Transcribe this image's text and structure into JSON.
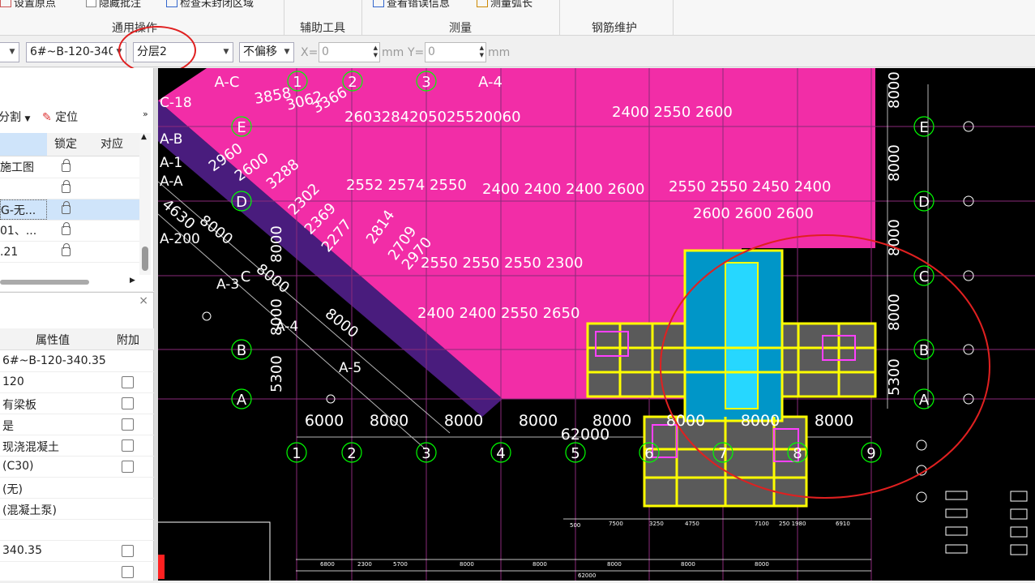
{
  "ribbon": {
    "set_origin": "设置原点",
    "hide_annotation": "隐藏批注",
    "check_closed_area": "检查未封闭区域",
    "view_error_info": "查看错误信息",
    "measure_arc": "测量弧长",
    "groups": [
      "通用操作",
      "辅助工具",
      "测量",
      "钢筋维护"
    ]
  },
  "toolbar": {
    "component_select": "6#~B-120-340",
    "layer_select": "分层2",
    "offset_select": "不偏移",
    "x_label": "X=",
    "x_value": "0",
    "y_label": "Y=",
    "y_value": "0",
    "unit": "mm"
  },
  "layer_panel": {
    "split_label": "分割",
    "locate_label": "定位",
    "columns": [
      "锁定",
      "对应"
    ],
    "rows": [
      {
        "name": "施工图"
      },
      {
        "name": ""
      },
      {
        "name": "G-无..."
      },
      {
        "name": "01、..."
      },
      {
        "name": ".21"
      }
    ]
  },
  "properties_panel": {
    "header_value": "属性值",
    "header_extra": "附加",
    "rows": [
      {
        "value": "6#~B-120-340.35",
        "checkbox": false
      },
      {
        "value": "120",
        "checkbox": true
      },
      {
        "value": "有梁板",
        "checkbox": true
      },
      {
        "value": "是",
        "checkbox": true
      },
      {
        "value": "现浇混凝土",
        "checkbox": true
      },
      {
        "value": "(C30)",
        "checkbox": true
      },
      {
        "value": "(无)",
        "checkbox": false
      },
      {
        "value": "(混凝土泵)",
        "checkbox": false
      },
      {
        "value": "",
        "checkbox": false
      },
      {
        "value": "340.35",
        "checkbox": true
      },
      {
        "value": "",
        "checkbox": true
      }
    ]
  },
  "drawing": {
    "colors": {
      "slab": "#ff2fb0",
      "grid": "#00ff00",
      "text": "#ffffff",
      "highlight": "#e02020",
      "steel": "#ffff00"
    },
    "axis_columns": [
      "1",
      "2",
      "3",
      "4",
      "5",
      "6",
      "7",
      "8",
      "9"
    ],
    "axis_rows": [
      "E",
      "D",
      "C",
      "B",
      "A"
    ],
    "top_axes": [
      "A-C",
      "1",
      "2",
      "3",
      "A-4"
    ],
    "left_axes": [
      "C-18",
      "A-B",
      "A-1",
      "A-A",
      "A-200",
      "A-3",
      "A-4",
      "A-5"
    ],
    "bottom_spans": [
      "6000",
      "8000",
      "8000",
      "8000",
      "8000",
      "8000",
      "8000",
      "8000"
    ],
    "total_span": "62000",
    "right_spans": [
      "8000",
      "8000",
      "8000",
      "8000",
      "5300"
    ],
    "left_span": "5300",
    "diagonal_dims": [
      "2960",
      "2600",
      "3288",
      "2302",
      "2369",
      "2277",
      "2814",
      "2709",
      "2970",
      "3366",
      "3062",
      "3858",
      "4630",
      "8000"
    ],
    "slab_dims_rows": [
      "2603284205025520060",
      "2552 2574 2550",
      "2400 2400 2400 2600",
      "2550 2550 2550 2300",
      "2400 2400 2550 2650"
    ],
    "right_slab_dims": [
      "2400 2550 2600",
      "2550 2550 2450 2400",
      "2600 2600 2600"
    ],
    "bottom_dims": [
      "6000",
      "8000",
      "8000",
      "8000",
      "8000",
      "8000",
      "8000",
      "8000"
    ],
    "tiny_dims": [
      "500",
      "7500",
      "3250",
      "4750",
      "7100",
      "250 1980",
      "6910",
      "6800",
      "2300",
      "5700",
      "8000",
      "8000",
      "8000",
      "8000",
      "8000",
      "62000"
    ]
  }
}
